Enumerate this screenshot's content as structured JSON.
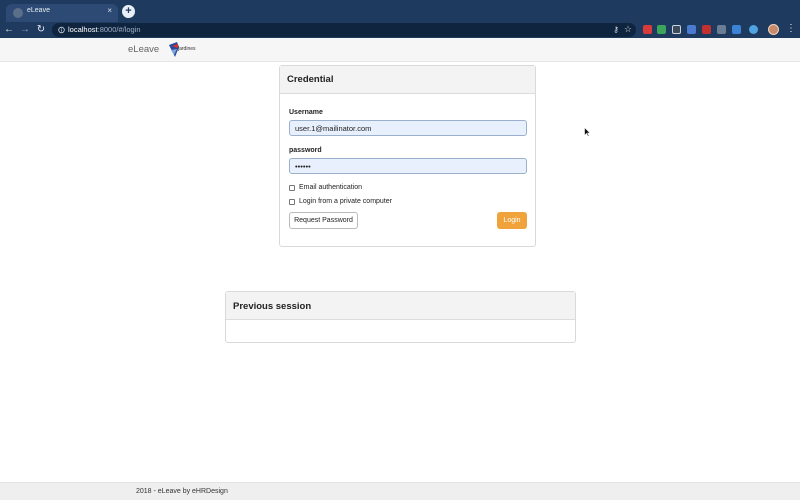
{
  "browser": {
    "tab_title": "eLeave",
    "tab_close": "×",
    "new_tab": "+",
    "url_host": "localhost",
    "url_rest": ":8000/#/login",
    "back": "←",
    "forward": "→",
    "reload": "↻"
  },
  "header": {
    "brand": "eLeave",
    "logo_text": "jardines"
  },
  "credential": {
    "title": "Credential",
    "username_label": "Username",
    "username_value": "user.1@mailinator.com",
    "password_label": "password",
    "password_value": "••••••",
    "email_auth_label": "Email authentication",
    "private_computer_label": "Login from a private computer",
    "request_password_label": "Request Password",
    "login_label": "Login"
  },
  "previous_session": {
    "title": "Previous session"
  },
  "footer": {
    "text": "2018 - eLeave by eHRDesign"
  },
  "colors": {
    "chrome": "#1e3a5f",
    "login_button": "#efa33a",
    "input_autofill": "#e8f0fe"
  }
}
